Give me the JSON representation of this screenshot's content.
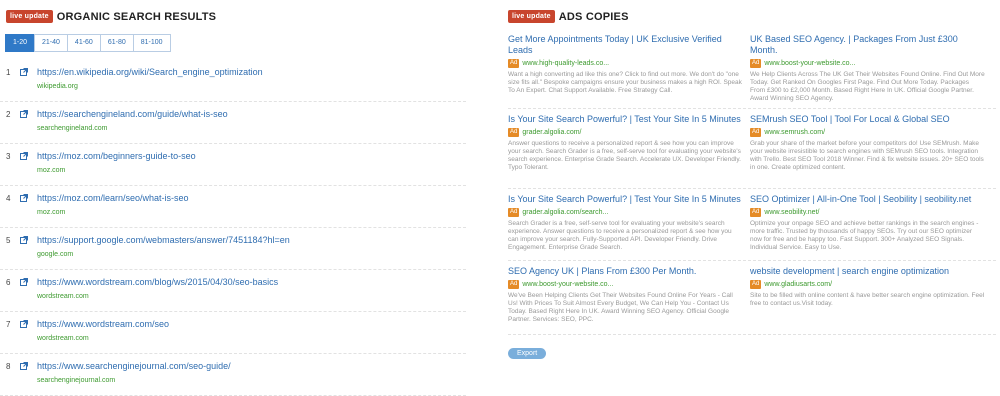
{
  "organic": {
    "badge": "live update",
    "title": "ORGANIC SEARCH RESULTS",
    "pages": [
      "1-20",
      "21-40",
      "41-60",
      "61-80",
      "81-100"
    ],
    "results": [
      {
        "n": "1",
        "url": "https://en.wikipedia.org/wiki/Search_engine_optimization",
        "domain": "wikipedia.org"
      },
      {
        "n": "2",
        "url": "https://searchengineland.com/guide/what-is-seo",
        "domain": "searchengineland.com"
      },
      {
        "n": "3",
        "url": "https://moz.com/beginners-guide-to-seo",
        "domain": "moz.com"
      },
      {
        "n": "4",
        "url": "https://moz.com/learn/seo/what-is-seo",
        "domain": "moz.com"
      },
      {
        "n": "5",
        "url": "https://support.google.com/webmasters/answer/7451184?hl=en",
        "domain": "google.com"
      },
      {
        "n": "6",
        "url": "https://www.wordstream.com/blog/ws/2015/04/30/seo-basics",
        "domain": "wordstream.com"
      },
      {
        "n": "7",
        "url": "https://www.wordstream.com/seo",
        "domain": "wordstream.com"
      },
      {
        "n": "8",
        "url": "https://www.searchenginejournal.com/seo-guide/",
        "domain": "searchenginejournal.com"
      }
    ]
  },
  "ads": {
    "badge": "live update",
    "title": "ADS COPIES",
    "ad_tag": "Ad",
    "items": [
      {
        "title": "Get More Appointments Today | UK Exclusive Verified Leads",
        "url": "www.high-quality-leads.co...",
        "desc": "Want a high converting ad like this one? Click to find out more. We don't do \"one size fits all.\" Bespoke campaigns ensure your business makes a high ROI. Speak To An Expert. Chat Support Available. Free Strategy Call."
      },
      {
        "title": "UK Based SEO Agency. | Packages From Just £300 Month.",
        "url": "www.boost-your-website.co...",
        "desc": "We Help Clients Across The UK Get Their Websites Found Online. Find Out More Today. Get Ranked On Googles First Page. Find Out More Today. Packages From £300 to £2,000 Month. Based Right Here In UK. Official Google Partner. Award Winning SEO Agency."
      },
      {
        "title": "Is Your Site Search Powerful? | Test Your Site In 5 Minutes",
        "url": "grader.algolia.com/",
        "desc": "Answer questions to receive a personalized report & see how you can improve your search. Search Grader is a free, self-serve tool for evaluating your website's search experience. Enterprise Grade Search. Accelerate UX. Developer Friendly. Typo Tolerant."
      },
      {
        "title": "SEMrush SEO Tool | Tool For Local & Global SEO",
        "url": "www.semrush.com/",
        "desc": "Grab your share of the market before your competitors do! Use SEMrush. Make your website irresistible to search engines with SEMrush SEO tools. Integration with Trello. Best SEO Tool 2018 Winner. Find & fix website issues. 20+ SEO tools in one. Create optimized content."
      },
      {
        "title": "Is Your Site Search Powerful? | Test Your Site In 5 Minutes",
        "url": "grader.algolia.com/search...",
        "desc": "Search Grader is a free, self-serve tool for evaluating your website's search experience. Answer questions to receive a personalized report & see how you can improve your search. Fully-Supported API. Developer Friendly. Drive Engagement. Enterprise Grade Search."
      },
      {
        "title": "SEO Optimizer | All-in-One Tool | Seobility | seobility.net",
        "url": "www.seobility.net/",
        "desc": "Optimize your onpage SEO and achieve better rankings in the search engines - more traffic. Trusted by thousands of happy SEOs. Try out our SEO optimizer now for free and be happy too. Fast Support. 300+ Analyzed SEO Signals. Individual Service. Easy to Use."
      },
      {
        "title": "SEO Agency UK | Plans From £300 Per Month.",
        "url": "www.boost-your-website.co...",
        "desc": "We've Been Helping Clients Get Their Websites Found Online For Years - Call Us! With Prices To Suit Almost Every Budget, We Can Help You - Contact Us Today. Based Right Here In UK. Award Winning SEO Agency. Official Google Partner. Services: SEO, PPC."
      },
      {
        "title": "website development | search engine optimization",
        "url": "www.gladiusarts.com/",
        "desc": "Site to be filled with online content & have better search engine optimization. Feel free to contact us.Visit today."
      }
    ],
    "export_label": "Export"
  }
}
